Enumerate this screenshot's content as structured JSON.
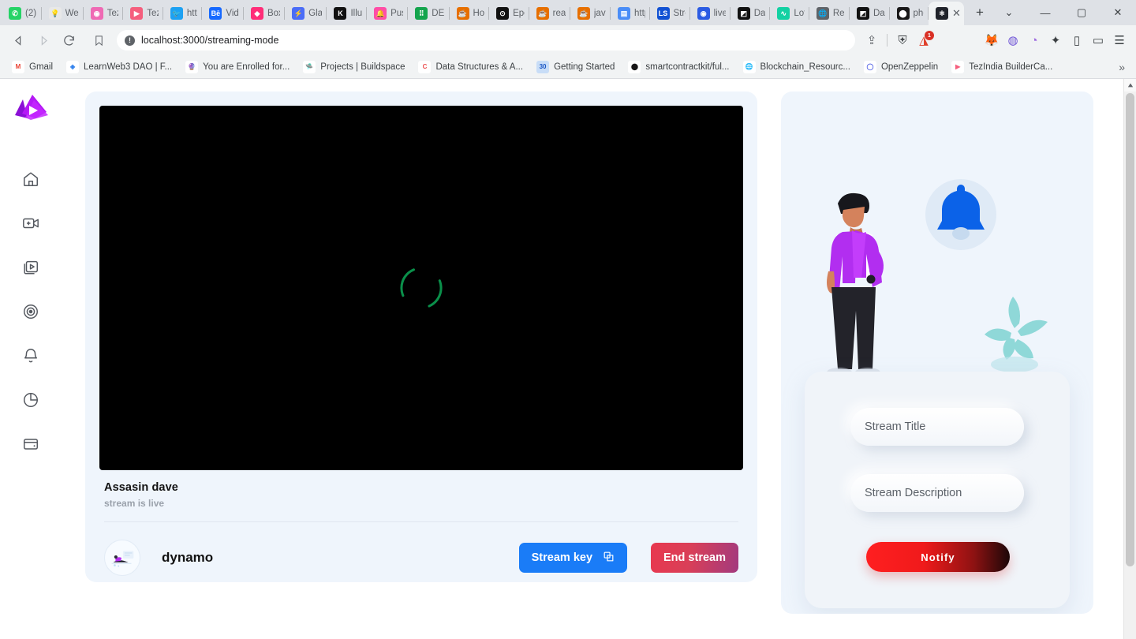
{
  "browser": {
    "tabs": [
      {
        "label": "(2) \\",
        "icon": "whatsapp-icon",
        "color": "#25d366",
        "glyph": "✆"
      },
      {
        "label": "Web",
        "icon": "lightbulb-icon",
        "color": "#e8e8e8",
        "glyph": "💡"
      },
      {
        "label": "Tezl",
        "icon": "tezos-icon",
        "color": "#ef6ab4",
        "glyph": "◉"
      },
      {
        "label": "Tezl",
        "icon": "folder-pink-icon",
        "color": "#f55f7e",
        "glyph": "▶"
      },
      {
        "label": "http",
        "icon": "twitter-icon",
        "color": "#1da1f2",
        "glyph": "🐦"
      },
      {
        "label": "Vide",
        "icon": "behance-icon",
        "color": "#1769ff",
        "glyph": "Bē"
      },
      {
        "label": "Boxi",
        "icon": "box-icon",
        "color": "#ff2d78",
        "glyph": "◆"
      },
      {
        "label": "Glas",
        "icon": "glass-icon",
        "color": "#4a6cf7",
        "glyph": "⚡"
      },
      {
        "label": "Illus",
        "icon": "kofi-icon",
        "color": "#111111",
        "glyph": "K"
      },
      {
        "label": "Pusl",
        "icon": "bell-pink-icon",
        "color": "#ff4da6",
        "glyph": "🔔"
      },
      {
        "label": "DEL",
        "icon": "dots-icon",
        "color": "#14a44d",
        "glyph": "⠿"
      },
      {
        "label": "Hov",
        "icon": "java-icon",
        "color": "#e76f00",
        "glyph": "☕"
      },
      {
        "label": "Epo",
        "icon": "clock-icon",
        "color": "#111111",
        "glyph": "⊙"
      },
      {
        "label": "reac",
        "icon": "java-icon",
        "color": "#e76f00",
        "glyph": "☕"
      },
      {
        "label": "java",
        "icon": "java-icon",
        "color": "#e76f00",
        "glyph": "☕"
      },
      {
        "label": "http",
        "icon": "doc-icon",
        "color": "#4a8df7",
        "glyph": "▤"
      },
      {
        "label": "Stre",
        "icon": "localstack-icon",
        "color": "#1151d3",
        "glyph": "LS"
      },
      {
        "label": "live-",
        "icon": "livepeer-icon",
        "color": "#2b5be3",
        "glyph": "◉"
      },
      {
        "label": "Das",
        "icon": "dash-icon",
        "color": "#111111",
        "glyph": "◩"
      },
      {
        "label": "Lott",
        "icon": "lottie-icon",
        "color": "#13d1a3",
        "glyph": "∿"
      },
      {
        "label": "Rea",
        "icon": "globe-icon",
        "color": "#5f6368",
        "glyph": "🌐"
      },
      {
        "label": "Das",
        "icon": "dash-icon",
        "color": "#111111",
        "glyph": "◩"
      },
      {
        "label": "pho",
        "icon": "github-icon",
        "color": "#181717",
        "glyph": "⬤"
      },
      {
        "label": "",
        "icon": "react-icon",
        "color": "#20232a",
        "glyph": "⚛",
        "active": true,
        "close_label": "✕"
      }
    ],
    "new_tab_label": "+",
    "window_controls": {
      "tab_search": "⌄",
      "minimize": "—",
      "maximize": "▢",
      "close": "✕"
    },
    "nav": {
      "back": "◁",
      "forward": "▷",
      "reload": "⟳",
      "bookmark": "🔖"
    },
    "address": {
      "url": "localhost:3000/streaming-mode",
      "info_glyph": "!"
    },
    "toolbar_right": [
      {
        "name": "share-icon",
        "glyph": "⇪",
        "color": "#5f6368"
      },
      {
        "name": "brave-shield-icon",
        "glyph": "⛨",
        "color": "#3c4043"
      },
      {
        "name": "brave-rewards-icon",
        "glyph": "◮",
        "color": "#e0402b",
        "badge": "1"
      },
      {
        "name": "metamask-icon",
        "glyph": "🦊",
        "color": "#f6851b"
      },
      {
        "name": "phantom-icon",
        "glyph": "◍",
        "color": "#6f54d6"
      },
      {
        "name": "extension-purple-icon",
        "glyph": "◔",
        "color": "#a06ee0"
      },
      {
        "name": "extensions-puzzle-icon",
        "glyph": "✦",
        "color": "#3c4043"
      },
      {
        "name": "sidebar-toggle-icon",
        "glyph": "▯",
        "color": "#3c4043"
      },
      {
        "name": "wallet-icon",
        "glyph": "▭",
        "color": "#3c4043"
      },
      {
        "name": "browser-menu-icon",
        "glyph": "☰",
        "color": "#3c4043"
      }
    ],
    "bookmarks": [
      {
        "label": "Gmail",
        "icon": "gmail-icon",
        "color": "#ffffff",
        "glyph": "M",
        "fg": "#ea4335"
      },
      {
        "label": "LearnWeb3 DAO | F...",
        "icon": "learnweb3-icon",
        "color": "#ffffff",
        "glyph": "◈",
        "fg": "#2f80ed"
      },
      {
        "label": "You are Enrolled for...",
        "icon": "crystal-ball-icon",
        "color": "#ffffff",
        "glyph": "🔮",
        "fg": "#9b51e0"
      },
      {
        "label": "Projects | Buildspace",
        "icon": "buildspace-icon",
        "color": "#ffffff",
        "glyph": "🛸",
        "fg": "#8c52ff"
      },
      {
        "label": "Data Structures & A...",
        "icon": "udemy-icon",
        "color": "#ffffff",
        "glyph": "C",
        "fg": "#ec5252"
      },
      {
        "label": "Getting Started",
        "icon": "thirty-icon",
        "color": "#c8ddf7",
        "glyph": "30",
        "fg": "#1a56c4"
      },
      {
        "label": "smartcontractkit/ful...",
        "icon": "github-icon",
        "color": "#ffffff",
        "glyph": "⬤",
        "fg": "#181717"
      },
      {
        "label": "Blockchain_Resourc...",
        "icon": "globe-dark-icon",
        "color": "#ffffff",
        "glyph": "🌐",
        "fg": "#111111"
      },
      {
        "label": "OpenZeppelin",
        "icon": "openzeppelin-icon",
        "color": "#ffffff",
        "glyph": "◯",
        "fg": "#4e5ee4"
      },
      {
        "label": "TezIndia BuilderCa...",
        "icon": "tezindia-icon",
        "color": "#ffffff",
        "glyph": "▶",
        "fg": "#f55f7e"
      }
    ],
    "bookmarks_overflow": "»"
  },
  "app": {
    "sidebar": {
      "logo_name": "app-logo",
      "items": [
        {
          "name": "home-icon",
          "label": "Home"
        },
        {
          "name": "add-video-icon",
          "label": "Go live"
        },
        {
          "name": "video-library-icon",
          "label": "Videos"
        },
        {
          "name": "target-icon",
          "label": "Goals"
        },
        {
          "name": "bell-icon",
          "label": "Notifications"
        },
        {
          "name": "pie-chart-icon",
          "label": "Analytics"
        },
        {
          "name": "wallet-icon",
          "label": "Wallet"
        }
      ]
    },
    "stream": {
      "title": "Assasin dave",
      "status": "stream is live",
      "username": "dynamo",
      "stream_key_button": "Stream key",
      "end_stream_button": "End stream",
      "player_state": "loading",
      "spinner_color": "#0a8f4a"
    },
    "notify": {
      "title_placeholder": "Stream Title",
      "title_value": "",
      "description_placeholder": "Stream Description",
      "description_value": "",
      "notify_button": "Notify",
      "illustration": "person-with-bell-illustration"
    },
    "colors": {
      "card_bg": "#eff5fc",
      "accent_blue": "#1a7cf7",
      "danger_red": "#e8384f",
      "notify_red": "#ff1f20",
      "logo_purple": "#a715f5"
    }
  }
}
